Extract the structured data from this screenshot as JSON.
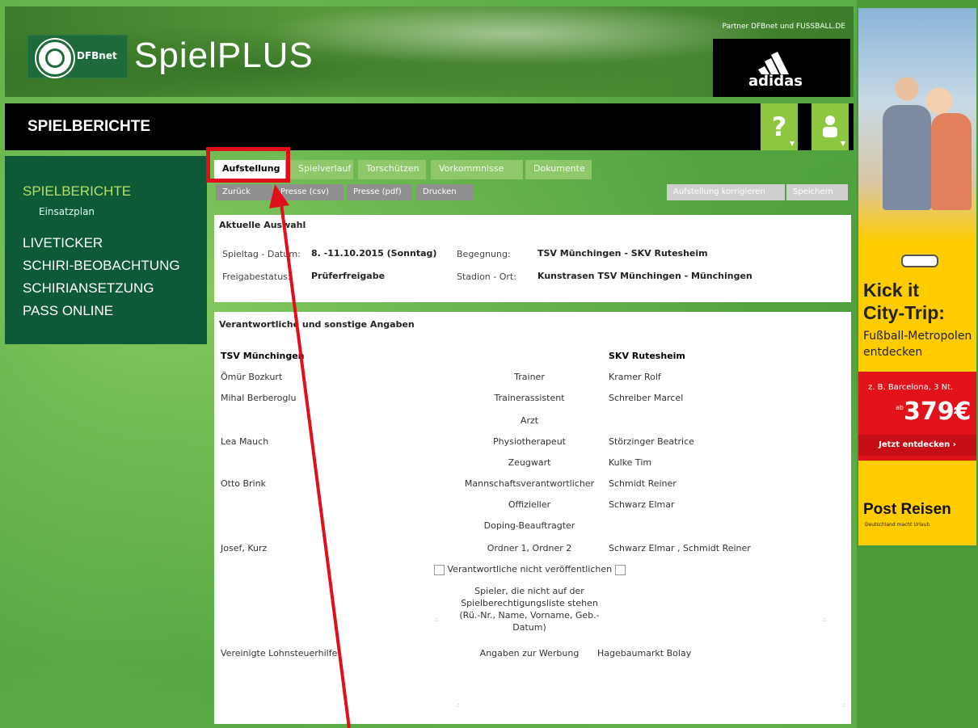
{
  "header": {
    "logo_text": "DFBnet",
    "brand": "SpielPLUS",
    "partner_text": "Partner DFBnet und FUSSBALL.DE",
    "sponsor": "adidas"
  },
  "titlebar": {
    "title": "SPIELBERICHTE",
    "help_label": "?",
    "user_label": "☺"
  },
  "sidebar": {
    "active": "SPIELBERICHTE",
    "sub": "Einsatzplan",
    "items": [
      "LIVETICKER",
      "SCHIRI-BEOBACHTUNG",
      "SCHIRIANSETZUNG",
      "PASS ONLINE"
    ]
  },
  "tabs": [
    "Aufstellung",
    "Spielverlauf",
    "Torschützen",
    "Vorkommnisse",
    "Dokumente"
  ],
  "toolbar": {
    "back": "Zurück",
    "press_csv": "Presse (csv)",
    "press_pdf": "Presse (pdf)",
    "print": "Drucken",
    "correct": "Aufstellung korrigieren",
    "save": "Speichern"
  },
  "selection": {
    "title": "Aktuelle Auswahl",
    "matchday_label": "Spieltag - Datum:",
    "matchday_value": "8. -11.10.2015 (Sonntag)",
    "encounter_label": "Begegnung:",
    "encounter_value": "TSV Münchingen - SKV Rutesheim",
    "status_label": "Freigabestatus:",
    "status_value": "Prüferfreigabe",
    "stadium_label": "Stadion - Ort:",
    "stadium_value": "Kunstrasen TSV Münchingen - Münchingen"
  },
  "officials": {
    "title": "Verantwortliche und sonstige Angaben",
    "home_team": "TSV Münchingen",
    "away_team": "SKV Rutesheim",
    "rows": [
      {
        "home": "Ömür Bozkurt",
        "role": "Trainer",
        "away": "Kramer Rolf"
      },
      {
        "home": "Mihal Berberoglu",
        "role": "Trainerassistent",
        "away": "Schreiber Marcel"
      },
      {
        "home": "",
        "role": "Arzt",
        "away": ""
      },
      {
        "home": "Lea Mauch",
        "role": "Physiotherapeut",
        "away": "Störzinger Beatrice"
      },
      {
        "home": "",
        "role": "Zeugwart",
        "away": "Kulke Tim"
      },
      {
        "home": "Otto Brink",
        "role": "Mannschaftsverantwortlicher",
        "away": "Schmidt Reiner"
      },
      {
        "home": "",
        "role": "Offizieller",
        "away": "Schwarz Elmar"
      },
      {
        "home": "",
        "role": "Doping-Beauftragter",
        "away": ""
      },
      {
        "home": "Josef, Kurz",
        "role": "Ordner 1, Ordner 2",
        "away": "Schwarz Elmar , Schmidt Reiner"
      }
    ],
    "not_publish_label": "Verantwortliche nicht veröffentlichen",
    "players_label": "Spieler, die nicht auf der Spielberechtigungsliste stehen (Rü.-Nr., Name, Vorname, Geb.-Datum)",
    "advert_home": "Vereinigte Lohnsteuerhilfe",
    "advert_label": "Angaben zur Werbung",
    "advert_away": "Hagebaumarkt Bolay"
  },
  "ad": {
    "headline1": "Kick it",
    "headline2": "City-Trip:",
    "sub1": "Fußball-Metropolen",
    "sub2": "entdecken",
    "offer": "z. B. Barcelona, 3 Nt.",
    "ab": "ab",
    "price": "379€",
    "cta": "Jetzt entdecken ›",
    "brand": "Post Reisen",
    "slogan": "Deutschland macht Urlaub"
  },
  "colors": {
    "accent": "#8dc63f",
    "sidebar": "#0f5a36",
    "highlight": "#e0101a",
    "ad": "#ffcc00"
  }
}
